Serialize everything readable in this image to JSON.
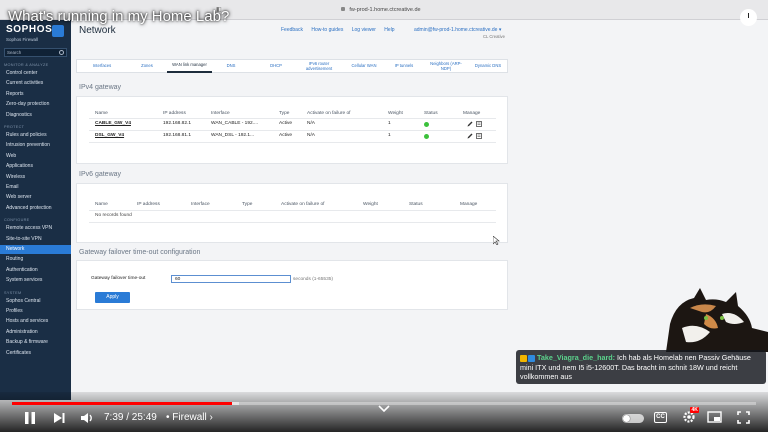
{
  "video": {
    "title": "What's running in my Home Lab?",
    "current_time": "7:39",
    "duration": "25:49",
    "time_display": "7:39 / 25:49",
    "chapter": "• Firewall ›",
    "hd_badge": "4K",
    "progress_played": 0.296,
    "progress_loaded": 0.305
  },
  "browser": {
    "url": "fw-prod-1.home.ctcreative.de"
  },
  "sidebar": {
    "brand": "SOPHOS",
    "brand_sub": "Sophos Firewall",
    "search_placeholder": "Search",
    "groups": [
      {
        "heading": "MONITOR & ANALYZE",
        "items": [
          "Control center",
          "Current activities",
          "Reports",
          "Zero-day protection",
          "Diagnostics"
        ]
      },
      {
        "heading": "PROTECT",
        "items": [
          "Rules and policies",
          "Intrusion prevention",
          "Web",
          "Applications",
          "Wireless",
          "Email",
          "Web server",
          "Advanced protection"
        ]
      },
      {
        "heading": "CONFIGURE",
        "items": [
          "Remote access VPN",
          "Site-to-site VPN",
          "Network",
          "Routing",
          "Authentication",
          "System services"
        ]
      },
      {
        "heading": "SYSTEM",
        "items": [
          "Sophos Central",
          "Profiles",
          "Hosts and services",
          "Administration",
          "Backup & firmware",
          "Certificates"
        ]
      }
    ],
    "active_item": "Network"
  },
  "main": {
    "title": "Network",
    "topnav": [
      "Feedback",
      "How-to guides",
      "Log viewer",
      "Help"
    ],
    "user": "admin@fw-prod-1.home.ctcreative.de",
    "user_sub": "CL Creative",
    "tabs": [
      "Interfaces",
      "Zones",
      "WAN link manager",
      "DNS",
      "DHCP",
      "IPv6 router advertisement",
      "Cellular WAN",
      "IP tunnels",
      "Neighbors (ARP-NDP)",
      "Dynamic DNS"
    ],
    "active_tab": "WAN link manager"
  },
  "ipv4": {
    "title": "IPv4 gateway",
    "columns": [
      "Name",
      "IP address",
      "Interface",
      "Type",
      "Activate on failure of",
      "Weight",
      "Status",
      "Manage"
    ],
    "rows": [
      {
        "name": "CABLE_GW_V4",
        "ip": "192.168.82.1",
        "interface": "WAN_CABLE - 192....",
        "type": "Active",
        "activate": "N/A",
        "weight": "1"
      },
      {
        "name": "DSL_GW_V4",
        "ip": "192.168.81.1",
        "interface": "WAN_DSL - 192.1...",
        "type": "Active",
        "activate": "N/A",
        "weight": "1"
      }
    ]
  },
  "ipv6": {
    "title": "IPv6 gateway",
    "columns": [
      "Name",
      "IP address",
      "Interface",
      "Type",
      "Activate on failure of",
      "Weight",
      "Status",
      "Manage"
    ],
    "empty_text": "No records found"
  },
  "failover": {
    "title": "Gateway failover time-out configuration",
    "label": "Gateway failover time-out",
    "value": "60",
    "hint": "seconds (1-65535)",
    "apply_label": "Apply"
  },
  "chat": {
    "username": "Take_Viagra_die_hard:",
    "message": "Ich hab als Homelab nen Passiv Gehäuse mini ITX und nem I5 i5-12600T. Das bracht im schnit 18W und reicht vollkommen aus"
  },
  "colors": {
    "sidebar": "#1a2e45",
    "accent": "#2a7bd6",
    "progress": "#ff0000",
    "status_ok": "#3cc13b"
  }
}
